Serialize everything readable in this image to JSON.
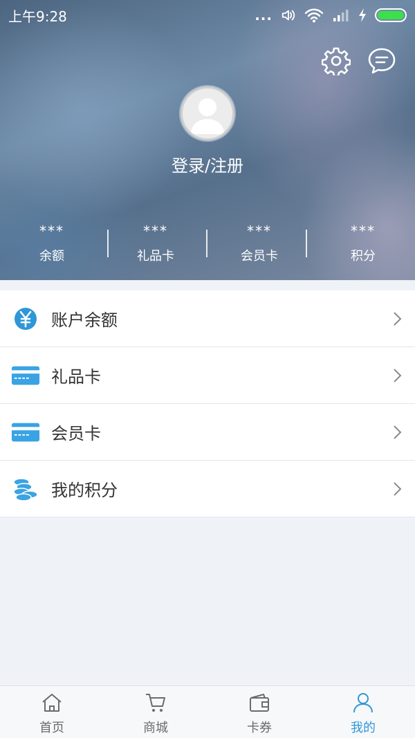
{
  "statusbar": {
    "time": "上午9:28",
    "dots": "..."
  },
  "header": {
    "login_label": "登录/注册"
  },
  "stats": [
    {
      "value": "***",
      "label": "余额"
    },
    {
      "value": "***",
      "label": "礼品卡"
    },
    {
      "value": "***",
      "label": "会员卡"
    },
    {
      "value": "***",
      "label": "积分"
    }
  ],
  "menu": [
    {
      "label": "账户余额",
      "icon": "yen-coin-icon"
    },
    {
      "label": "礼品卡",
      "icon": "card-icon"
    },
    {
      "label": "会员卡",
      "icon": "card-icon"
    },
    {
      "label": "我的积分",
      "icon": "coin-stack-icon"
    }
  ],
  "tabs": [
    {
      "label": "首页",
      "icon": "home-icon"
    },
    {
      "label": "商城",
      "icon": "cart-icon"
    },
    {
      "label": "卡券",
      "icon": "wallet-icon"
    },
    {
      "label": "我的",
      "icon": "user-icon",
      "active": true
    }
  ],
  "colors": {
    "accent": "#2e97d8",
    "card_blue": "#3aa3e3"
  }
}
